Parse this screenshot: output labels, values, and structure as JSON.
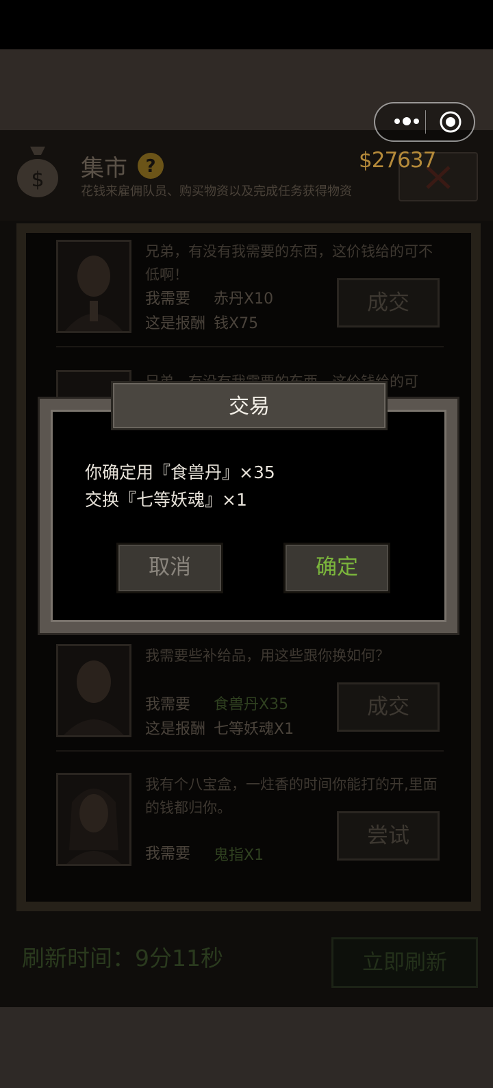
{
  "header": {
    "title": "集市",
    "subtitle": "花钱来雇佣队员、购买物资以及完成任务获得物资",
    "coins": "$27637",
    "close_label": "✕"
  },
  "trades": [
    {
      "quote": "兄弟，有没有我需要的东西，这价钱给的可不低啊！",
      "need_label": "我需要",
      "need_value": "赤丹X10",
      "reward_label": "这是报酬",
      "reward_value": "钱X75",
      "button": "成交"
    },
    {
      "quote": "兄弟，有没有我需要的东西，这价钱给的可",
      "button": ""
    },
    {
      "quote": "我需要些补给品，用这些跟你换如何？",
      "need_label": "我需要",
      "need_value": "食兽丹X35",
      "reward_label": "这是报酬",
      "reward_value": "七等妖魂X1",
      "button": "成交"
    },
    {
      "quote": "我有个八宝盒，一炷香的时间你能打的开,里面的钱都归你。",
      "need_label": "我需要",
      "need_value": "鬼指X1",
      "button": "尝试"
    }
  ],
  "refresh": {
    "time_text": "刷新时间：9分11秒",
    "button": "立即刷新"
  },
  "dialog": {
    "title": "交易",
    "line1": "你确定用『食兽丹』×35",
    "line2": "交换『七等妖魂』×1",
    "cancel": "取消",
    "confirm": "确定"
  },
  "colors": {
    "accent_gold": "#b58a3a",
    "confirm_green": "#7bb63c"
  }
}
